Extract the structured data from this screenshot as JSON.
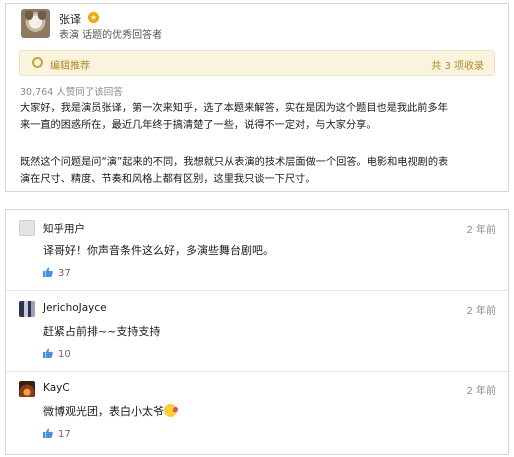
{
  "answer": {
    "author": {
      "name": "张译",
      "bio": "表演 话题的优秀回答者"
    },
    "edit_bar": {
      "label": "编辑推荐",
      "count": "共 3 项收录"
    },
    "votes": "30,764 人赞同了该回答",
    "paragraphs": [
      [
        "大家好，我是演员张译，第一次来知乎，选了本题来解答，实在是因为这个题目也是我此前多年",
        "来一直的困惑所在，最近几年终于搞清楚了一些，说得不一定对，与大家分享。"
      ],
      [
        "既然这个问题是问“演”起来的不同，我想就只从表演的技术层面做一个回答。电影和电视剧的表",
        "演在尺寸、精度、节奏和风格上都有区别，这里我只谈一下尺寸。"
      ]
    ]
  },
  "comments": [
    {
      "user": "知乎用户",
      "time": "2 年前",
      "text": "译哥好！你声音条件这么好，多演些舞台剧吧。",
      "likes": "37"
    },
    {
      "user": "JerichoJayce",
      "time": "2 年前",
      "text": "赶紧占前排~~支持支持",
      "likes": "10"
    },
    {
      "user": "KayC",
      "time": "2 年前",
      "text": "微博观光团，表白小太爷",
      "likes": "17"
    }
  ],
  "colors": {
    "accent": "#b08a2a",
    "badge": "#f7a600",
    "like_icon": "#4a8fe0"
  },
  "icons": {
    "badge": "star-badge-icon",
    "edit": "gear-icon",
    "like": "thumb-up-icon",
    "emoji": "blush-kiss-emoji-icon"
  }
}
